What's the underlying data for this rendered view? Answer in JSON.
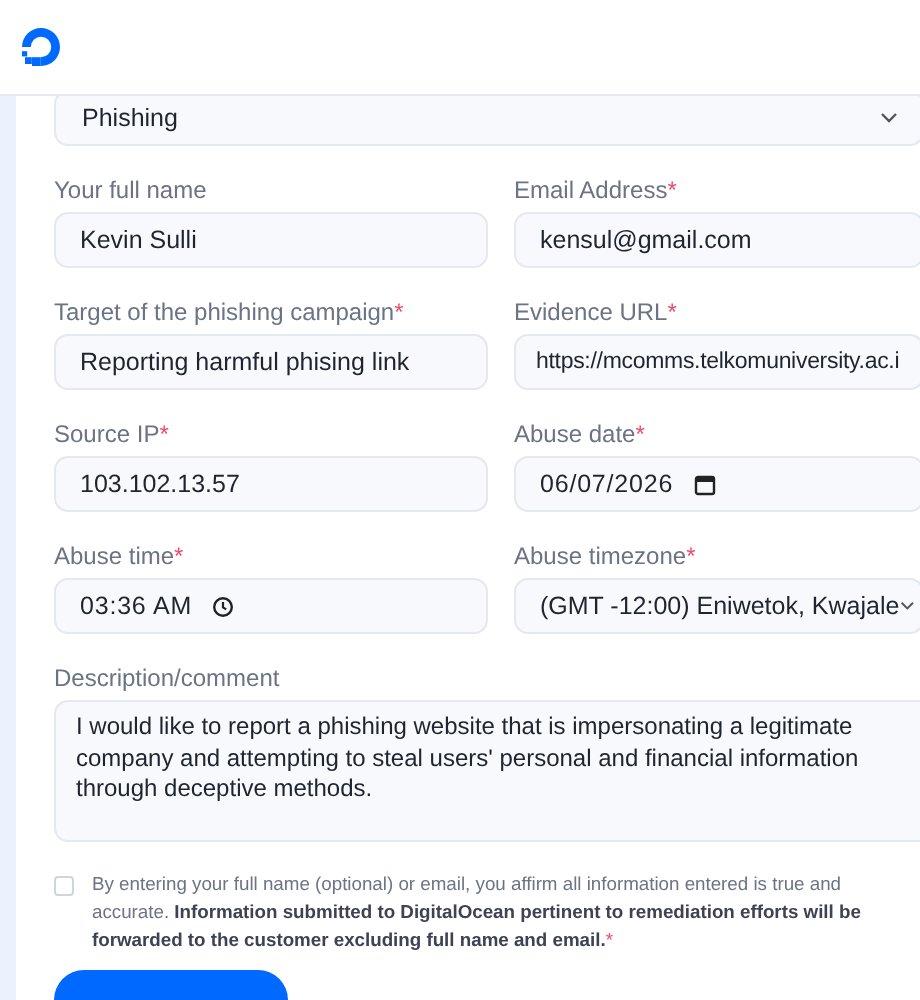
{
  "abuse_type": {
    "value": "Phishing"
  },
  "fields": [
    {
      "label": "Your full name",
      "kind": "text",
      "value": "Kevin Sulli"
    },
    {
      "label": "Email Address",
      "required_mark": "*",
      "kind": "text",
      "value": "kensul@gmail.com"
    },
    {
      "label": "Target of the phishing campaign",
      "required_mark": "*",
      "kind": "text",
      "value": "Reporting harmful phising link"
    },
    {
      "label": "Evidence URL",
      "required_mark": "*",
      "kind": "text",
      "value": "https://mcomms.telkomuniversity.ac.i"
    },
    {
      "label": "Source IP",
      "required_mark": "*",
      "kind": "text",
      "value": "103.102.13.57"
    },
    {
      "label": "Abuse date",
      "required_mark": "*",
      "kind": "date",
      "value": "06/07/2026"
    },
    {
      "label": "Abuse time",
      "required_mark": "*",
      "kind": "time",
      "value": "03:36 AM"
    },
    {
      "label": "Abuse timezone",
      "required_mark": "*",
      "kind": "select",
      "value": "(GMT -12:00) Eniwetok, Kwajale"
    }
  ],
  "description": {
    "label": "Description/comment",
    "value": "I would like to report a phishing website that is impersonating a legitimate company and attempting to steal users' personal and financial information through deceptive methods."
  },
  "consent": {
    "checked": false,
    "required_mark": "*",
    "text": "By entering your full name (optional) or email, you affirm all information entered is true and accurate. **Information submitted to DigitalOcean pertinent to remediation efforts will be forwarded to the customer excluding full name and email.**"
  }
}
